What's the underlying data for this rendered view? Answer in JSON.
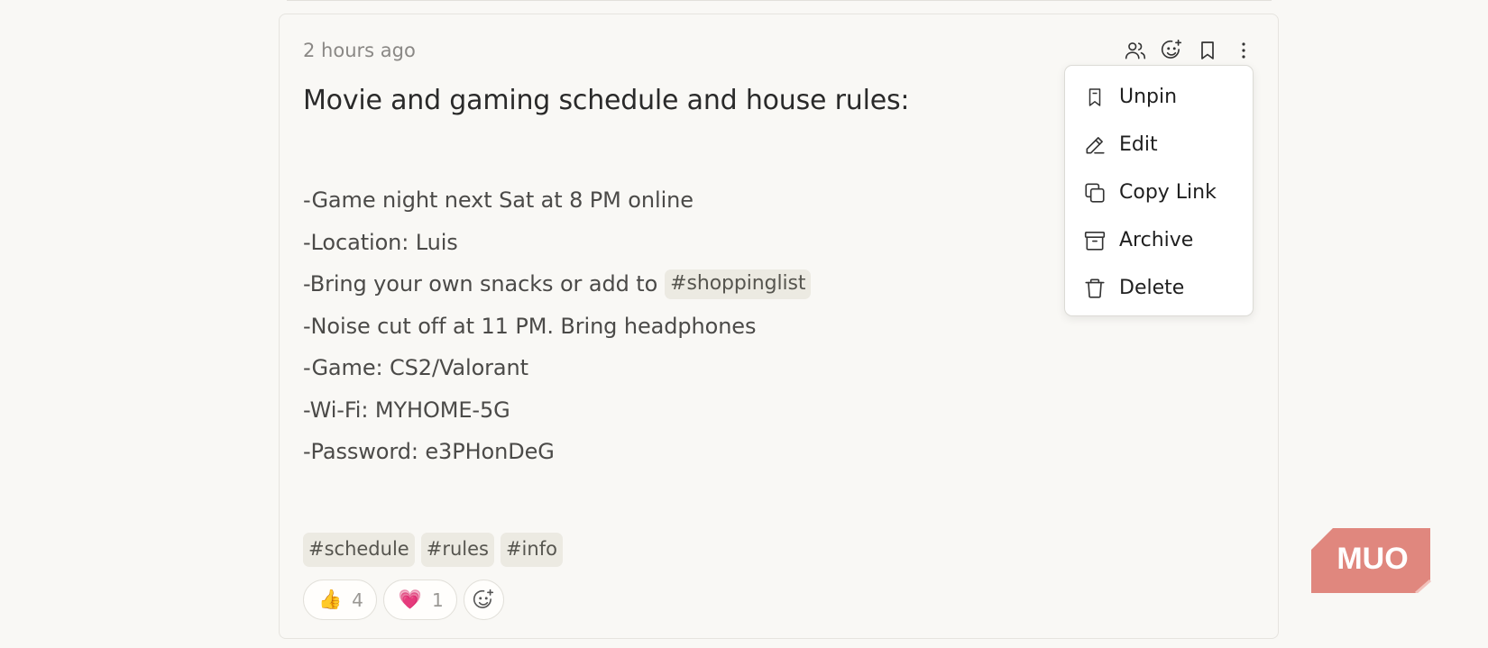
{
  "memo": {
    "timestamp": "2 hours ago",
    "title": "Movie and gaming schedule and house rules:",
    "lines": [
      "-Game night next Sat at 8 PM online",
      "-Location: Luis",
      "-Bring your own snacks or add to",
      "-Noise cut off at 11 PM. Bring headphones",
      "-Game: CS2/Valorant",
      "-Wi-Fi: MYHOME-5G",
      "-Password: e3PHonDeG"
    ],
    "inline_tag": "#shoppinglist",
    "tags": [
      "#schedule",
      "#rules",
      "#info"
    ],
    "reactions": [
      {
        "emoji": "👍",
        "count": "4"
      },
      {
        "emoji": "💗",
        "count": "1"
      }
    ]
  },
  "top_actions": {
    "icons": [
      "users-icon",
      "add-reaction-icon",
      "bookmark-icon",
      "more-vertical-icon"
    ]
  },
  "menu": {
    "items": [
      {
        "label": "Unpin",
        "icon": "bookmark-icon"
      },
      {
        "label": "Edit",
        "icon": "pencil-icon"
      },
      {
        "label": "Copy Link",
        "icon": "copy-icon"
      },
      {
        "label": "Archive",
        "icon": "archive-icon"
      },
      {
        "label": "Delete",
        "icon": "trash-icon"
      }
    ]
  },
  "watermark": {
    "text": "MUO",
    "color": "#e0877e"
  },
  "colors": {
    "background": "#f9f8f5",
    "tag_bg": "#eceae2",
    "text": "#4b4a48"
  }
}
